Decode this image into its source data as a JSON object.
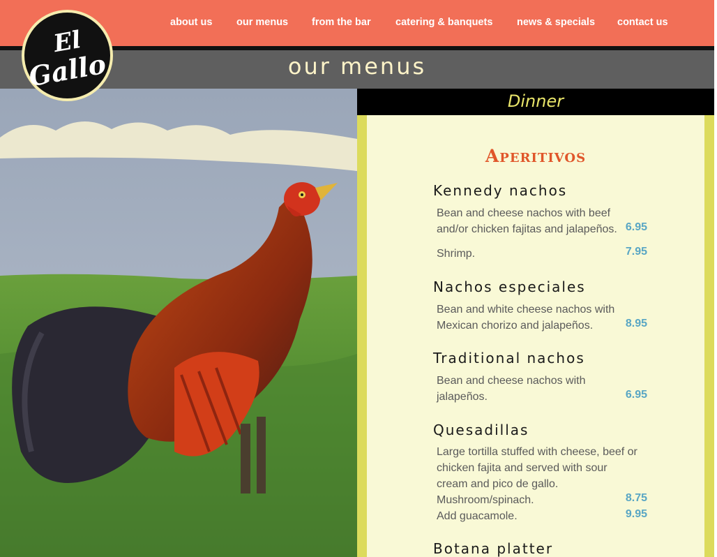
{
  "nav": {
    "items": [
      "about us",
      "our menus",
      "from the bar",
      "catering & banquets",
      "news & specials",
      "contact us"
    ]
  },
  "logo": {
    "line1": "El",
    "line2": "Gallo"
  },
  "page_title": "our menus",
  "menu_tab": "Dinner",
  "section": {
    "title": "Aperitivos",
    "dishes": [
      {
        "name": "Kennedy nachos",
        "desc1": "Bean and cheese nachos with beef",
        "desc2": "and/or chicken fajitas and jalapeños.",
        "price1": "6.95",
        "extra": "Shrimp.",
        "price2": "7.95"
      },
      {
        "name": "Nachos especiales",
        "desc1": "Bean and white cheese nachos with",
        "desc2": "Mexican chorizo and jalapeños.",
        "price1": "8.95"
      },
      {
        "name": "Traditional nachos",
        "desc1": "Bean and cheese nachos with",
        "desc2": "jalapeños.",
        "price1": "6.95"
      },
      {
        "name": "Quesadillas",
        "desc1": "Large tortilla stuffed with cheese, beef or",
        "desc2": "chicken fajita and served with sour",
        "desc3": "cream and pico de gallo.",
        "opt1": "Mushroom/spinach.",
        "price1": "8.75",
        "opt2": "Add guacamole.",
        "price2": "9.95"
      },
      {
        "name": "Botana platter"
      }
    ]
  },
  "colors": {
    "nav_bar": "#f26f57",
    "title_band": "#5f5f5f",
    "title_text": "#fdf3c8",
    "menu_bg": "#f9f9d6",
    "menu_border": "#dcdb5c",
    "section_title": "#e0562a",
    "price": "#59a6c4"
  }
}
